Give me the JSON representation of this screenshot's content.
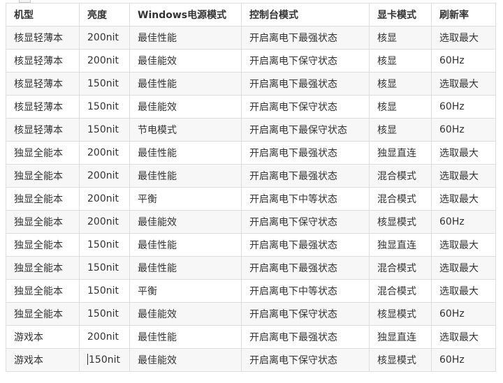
{
  "table": {
    "headers": [
      "机型",
      "亮度",
      "Windows电源模式",
      "控制台模式",
      "显卡模式",
      "刷新率"
    ],
    "rows": [
      [
        "核显轻薄本",
        "200nit",
        "最佳性能",
        "开启离电下最强状态",
        "核显",
        "选取最大"
      ],
      [
        "核显轻薄本",
        "200nit",
        "最佳能效",
        "开启离电下保守状态",
        "核显",
        "60Hz"
      ],
      [
        "核显轻薄本",
        "150nit",
        "最佳性能",
        "开启离电下最强状态",
        "核显",
        "选取最大"
      ],
      [
        "核显轻薄本",
        "150nit",
        "最佳能效",
        "开启离电下保守状态",
        "核显",
        "60Hz"
      ],
      [
        "核显轻薄本",
        "150nit",
        "节电模式",
        "开启离电下最保守状态",
        "核显",
        "60Hz"
      ],
      [
        "独显全能本",
        "200nit",
        "最佳性能",
        "开启离电下最强状态",
        "独显直连",
        "选取最大"
      ],
      [
        "独显全能本",
        "200nit",
        "最佳性能",
        "开启离电下最强状态",
        "混合模式",
        "选取最大"
      ],
      [
        "独显全能本",
        "200nit",
        "平衡",
        "开启离电下中等状态",
        "混合模式",
        "选取最大"
      ],
      [
        "独显全能本",
        "200nit",
        "最佳能效",
        "开启离电下保守状态",
        "核显模式",
        "60Hz"
      ],
      [
        "独显全能本",
        "150nit",
        "最佳性能",
        "开启离电下最强状态",
        "独显直连",
        "选取最大"
      ],
      [
        "独显全能本",
        "150nit",
        "最佳性能",
        "开启离电下最强状态",
        "混合模式",
        "选取最大"
      ],
      [
        "独显全能本",
        "150nit",
        "平衡",
        "开启离电下中等状态",
        "混合模式",
        "选取最大"
      ],
      [
        "独显全能本",
        "150nit",
        "最佳能效",
        "开启离电下保守状态",
        "核显模式",
        "60Hz"
      ],
      [
        "游戏本",
        "200nit",
        "最佳性能",
        "开启离电下最强状态",
        "独显直连",
        "选取最大"
      ],
      [
        "游戏本",
        "150nit",
        "最佳能效",
        "开启离电下保守状态",
        "核显模式",
        "60Hz"
      ]
    ]
  }
}
